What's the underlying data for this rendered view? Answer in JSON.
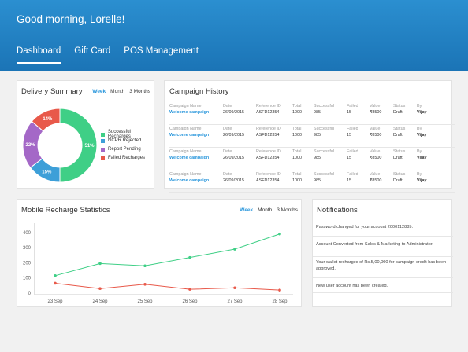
{
  "header": {
    "greeting": "Good morning, Lorelle!",
    "nav": [
      "Dashboard",
      "Gift Card",
      "POS Management"
    ],
    "active_nav": "Dashboard"
  },
  "delivery": {
    "title": "Delivery Summary",
    "ranges": [
      "Week",
      "Month",
      "3 Months"
    ],
    "active_range": "Week",
    "legend": [
      {
        "label": "Successful Recharges",
        "color": "#3fcf86"
      },
      {
        "label": "NCPR Rejected",
        "color": "#3d9fd8"
      },
      {
        "label": "Report Pending",
        "color": "#a468c7"
      },
      {
        "label": "Failed Recharges",
        "color": "#e8594a"
      }
    ],
    "slices": [
      {
        "label": "51%",
        "value": 51,
        "color": "#3fcf86"
      },
      {
        "label": "15%",
        "value": 15,
        "color": "#3d9fd8"
      },
      {
        "label": "22%",
        "value": 22,
        "color": "#a468c7"
      },
      {
        "label": "14%",
        "value": 14,
        "color": "#e8594a"
      }
    ]
  },
  "campaign": {
    "title": "Campaign History",
    "headers": [
      "Campaign Name",
      "Date",
      "Reference ID",
      "Total",
      "Successful",
      "Failed",
      "Value",
      "Status",
      "By"
    ],
    "rows": [
      [
        "Welcome campaign",
        "26/09/2015",
        "ASFD12354",
        "1000",
        "985",
        "15",
        "₹8500",
        "Draft",
        "Vijay"
      ],
      [
        "Welcome campaign",
        "26/09/2015",
        "ASFD12354",
        "1000",
        "985",
        "15",
        "₹8500",
        "Draft",
        "Vijay"
      ],
      [
        "Welcome campaign",
        "26/09/2015",
        "ASFD12354",
        "1000",
        "985",
        "15",
        "₹8500",
        "Draft",
        "Vijay"
      ],
      [
        "Welcome campaign",
        "26/09/2015",
        "ASFD12354",
        "1000",
        "985",
        "15",
        "₹8500",
        "Draft",
        "Vijay"
      ]
    ]
  },
  "stats": {
    "title": "Mobile Recharge Statistics",
    "ranges": [
      "Week",
      "Month",
      "3 Months"
    ],
    "active_range": "Week"
  },
  "notifications": {
    "title": "Notifications",
    "items": [
      "Password changed for your account 2000112885.",
      "Account Converted from Sales & Marketing to Administrator.",
      "Your wallet recharges of Rs.5,00,000 for campaign credit has been approved.",
      "New user account has been created."
    ]
  },
  "chart_data": {
    "type": "line",
    "categories": [
      "23 Sep",
      "24 Sep",
      "25 Sep",
      "26 Sep",
      "27 Sep",
      "28 Sep"
    ],
    "yticks": [
      0,
      100,
      200,
      300,
      400
    ],
    "ylim": [
      0,
      430
    ],
    "series": [
      {
        "values": [
          115,
          195,
          180,
          235,
          290,
          390
        ],
        "color": "#3fcf86"
      },
      {
        "values": [
          65,
          30,
          58,
          25,
          35,
          20
        ],
        "color": "#e8594a"
      }
    ]
  }
}
